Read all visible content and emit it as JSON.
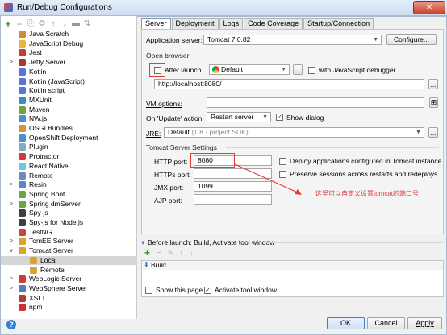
{
  "window": {
    "title": "Run/Debug Configurations",
    "close_label": "✕"
  },
  "toolbar": {
    "add": "+",
    "remove": "−"
  },
  "tree": [
    {
      "label": "Java Scratch",
      "indent": 1,
      "arrow": "",
      "color": "#d4893a"
    },
    {
      "label": "JavaScript Debug",
      "indent": 1,
      "arrow": "",
      "color": "#e9b73c"
    },
    {
      "label": "Jest",
      "indent": 1,
      "arrow": "",
      "color": "#c63c3c"
    },
    {
      "label": "Jetty Server",
      "indent": 1,
      "arrow": ">",
      "color": "#b0332f"
    },
    {
      "label": "Kotlin",
      "indent": 1,
      "arrow": "",
      "color": "#5a73d8"
    },
    {
      "label": "Kotlin (JavaScript)",
      "indent": 1,
      "arrow": "",
      "color": "#5a73d8"
    },
    {
      "label": "Kotlin script",
      "indent": 1,
      "arrow": "",
      "color": "#5a73d8"
    },
    {
      "label": "MXUnit",
      "indent": 1,
      "arrow": "",
      "color": "#3b8bc7"
    },
    {
      "label": "Maven",
      "indent": 1,
      "arrow": "",
      "color": "#6da640"
    },
    {
      "label": "NW.js",
      "indent": 1,
      "arrow": "",
      "color": "#4a8fd1"
    },
    {
      "label": "OSGi Bundles",
      "indent": 1,
      "arrow": "",
      "color": "#d8923a"
    },
    {
      "label": "OpenShift Deployment",
      "indent": 1,
      "arrow": "",
      "color": "#4a8fd1"
    },
    {
      "label": "Plugin",
      "indent": 1,
      "arrow": "",
      "color": "#87a9c9"
    },
    {
      "label": "Protractor",
      "indent": 1,
      "arrow": "",
      "color": "#d03a3a"
    },
    {
      "label": "React Native",
      "indent": 1,
      "arrow": "",
      "color": "#6ac6e8"
    },
    {
      "label": "Remote",
      "indent": 1,
      "arrow": "",
      "color": "#6b8eb7"
    },
    {
      "label": "Resin",
      "indent": 1,
      "arrow": ">",
      "color": "#5a87c5"
    },
    {
      "label": "Spring Boot",
      "indent": 1,
      "arrow": "",
      "color": "#6da640"
    },
    {
      "label": "Spring dmServer",
      "indent": 1,
      "arrow": ">",
      "color": "#6da640"
    },
    {
      "label": "Spy-js",
      "indent": 1,
      "arrow": "",
      "color": "#404040"
    },
    {
      "label": "Spy-js for Node.js",
      "indent": 1,
      "arrow": "",
      "color": "#404040"
    },
    {
      "label": "TestNG",
      "indent": 1,
      "arrow": "",
      "color": "#c94444"
    },
    {
      "label": "TomEE Server",
      "indent": 1,
      "arrow": ">",
      "color": "#d7a430"
    },
    {
      "label": "Tomcat Server",
      "indent": 1,
      "arrow": "v",
      "color": "#d7a430"
    },
    {
      "label": "Local",
      "indent": 2,
      "arrow": "",
      "color": "#d7a430",
      "selected": true
    },
    {
      "label": "Remote",
      "indent": 2,
      "arrow": "",
      "color": "#d7a430"
    },
    {
      "label": "WebLogic Server",
      "indent": 1,
      "arrow": ">",
      "color": "#d03a3a"
    },
    {
      "label": "WebSphere Server",
      "indent": 1,
      "arrow": ">",
      "color": "#4f7fbf"
    },
    {
      "label": "XSLT",
      "indent": 1,
      "arrow": "",
      "color": "#b53a3a"
    },
    {
      "label": "npm",
      "indent": 1,
      "arrow": "",
      "color": "#c83232"
    }
  ],
  "tabs": [
    "Server",
    "Deployment",
    "Logs",
    "Code Coverage",
    "Startup/Connection"
  ],
  "server": {
    "app_server_label": "Application server:",
    "app_server_value": "Tomcat 7.0.82",
    "configure_label": "Configure...",
    "open_browser_label": "Open browser",
    "after_launch_label": "After launch",
    "browser_value": "Default",
    "browse_dots": "...",
    "js_debugger_label": "with JavaScript debugger",
    "url_value": "http://localhost:8080/",
    "vm_options_label": "VM options:",
    "vm_options_value": "",
    "update_action_label": "On 'Update' action:",
    "update_action_value": "Restart server",
    "show_dialog_label": "Show dialog",
    "jre_label": "JRE:",
    "jre_value": "Default",
    "jre_hint": "(1.8 - project SDK)",
    "tomcat_settings_label": "Tomcat Server Settings",
    "http_port_label": "HTTP port:",
    "http_port_value": "8080",
    "https_port_label": "HTTPs port:",
    "https_port_value": "",
    "jmx_port_label": "JMX port:",
    "jmx_port_value": "1099",
    "ajp_port_label": "AJP port:",
    "ajp_port_value": "",
    "deploy_label": "Deploy applications configured in Tomcat instance",
    "preserve_label": "Preserve sessions across restarts and redeploys",
    "annotation": "这里可以自定义设置tomcat的端口号"
  },
  "before_launch": {
    "label": "Before launch: Build, Activate tool window",
    "item": "Build"
  },
  "bottom": {
    "show_page_label": "Show this page",
    "activate_label": "Activate tool window",
    "ok_label": "OK",
    "cancel_label": "Cancel",
    "apply_label": "Apply",
    "help_label": "?"
  },
  "colors": {
    "accent": "#2f7fd8",
    "annotation": "#e23b3b"
  }
}
